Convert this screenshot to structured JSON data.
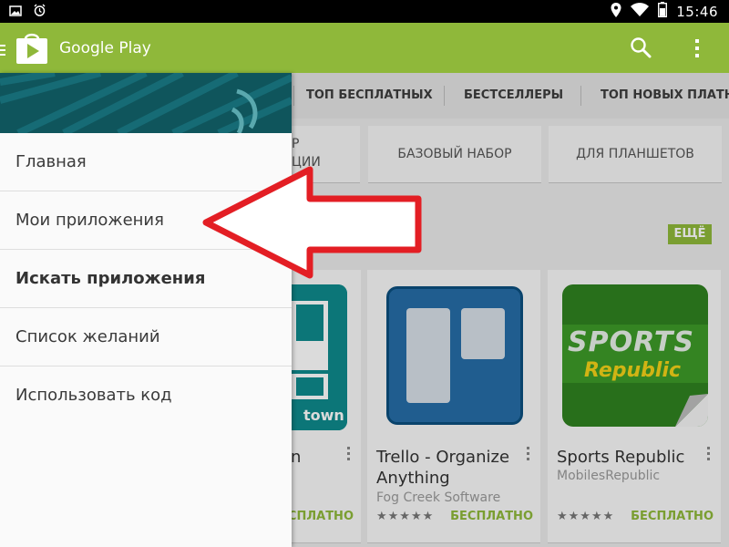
{
  "status_bar": {
    "clock": "15:46",
    "icons": [
      "picture-icon",
      "alarm-icon",
      "location-icon",
      "wifi-icon",
      "battery-icon"
    ]
  },
  "action_bar": {
    "title": "Google Play",
    "icons": [
      "drawer-icon",
      "play-store-logo",
      "search-icon",
      "overflow-menu-icon"
    ],
    "color": "#8fb83a"
  },
  "tabs": [
    "ТОП БЕСПЛАТНЫХ",
    "БЕСТСЕЛЛЕРЫ",
    "ТОП НОВЫХ ПЛАТНЫ"
  ],
  "categories": {
    "partial_line1": "Р",
    "partial_line2": "ЦИИ",
    "basic_set": "БАЗОВЫЙ НАБОР",
    "tablets": "ДЛЯ ПЛАНШЕТОВ"
  },
  "more_badge": "ЕЩЁ",
  "apps": [
    {
      "name": "n",
      "developer": "",
      "price": "ЕСПЛАТНО",
      "logo_text": "town"
    },
    {
      "name": "Trello - Organize Anything",
      "developer": "Fog Creek Software",
      "price": "БЕСПЛАТНО",
      "rating": "★★★★★"
    },
    {
      "name": "Sports Republic",
      "developer": "MobilesRepublic",
      "price": "БЕСПЛАТНО",
      "rating": "★★★★★",
      "logo_line1": "SPORTS",
      "logo_line2": "Republic"
    }
  ],
  "drawer": {
    "items": [
      "Главная",
      "Мои приложения",
      "Искать приложения",
      "Список желаний",
      "Использовать код"
    ],
    "bold_item": "Искать приложения"
  },
  "annotation": {
    "arrow_color": "#e31e24",
    "points_to": "Мои приложения"
  }
}
